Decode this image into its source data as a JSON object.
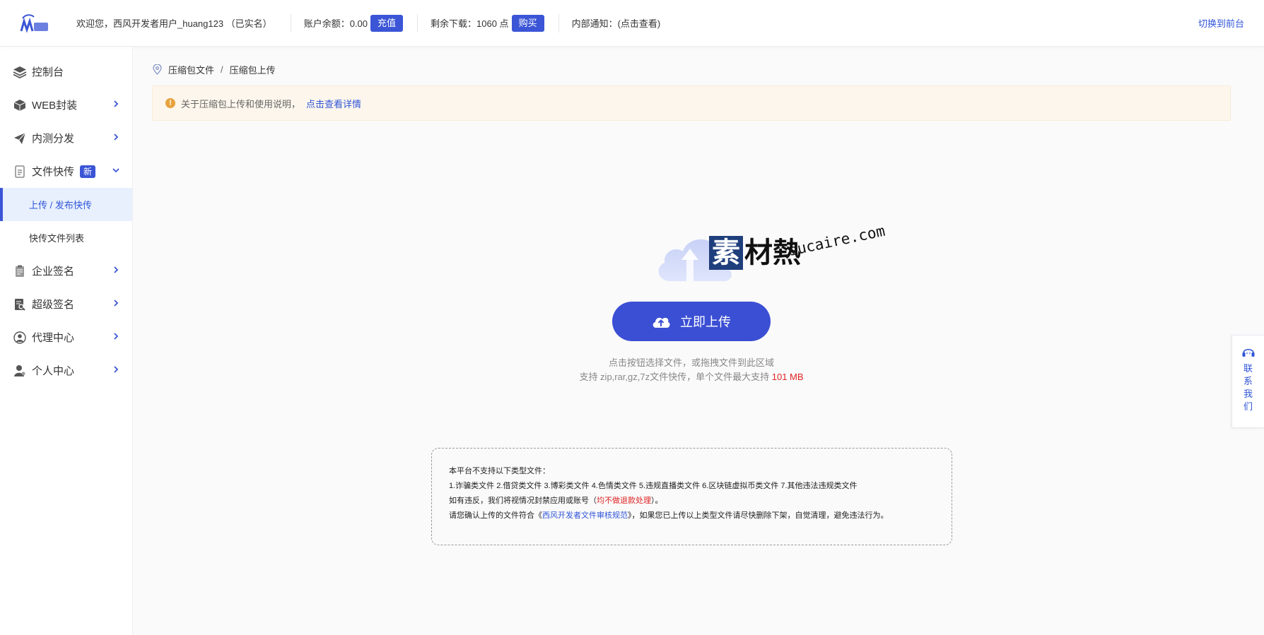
{
  "header": {
    "welcome": "欢迎您，西风开发者用户_huang123 （已实名）",
    "balance_label": "账户余额：0.00",
    "recharge_button": "充值",
    "downloads_label": "剩余下载：1060 点",
    "buy_button": "购买",
    "notice": "内部通知：(点击查看)",
    "switch_link": "切换到前台"
  },
  "sidebar": {
    "items": [
      {
        "label": "控制台",
        "icon": "layers-icon"
      },
      {
        "label": "WEB封装",
        "icon": "box-icon"
      },
      {
        "label": "内测分发",
        "icon": "paper-plane-icon"
      },
      {
        "label": "文件快传",
        "icon": "file-transfer-icon",
        "badge": "新"
      },
      {
        "label": "企业签名",
        "icon": "clipboard-icon"
      },
      {
        "label": "超级签名",
        "icon": "document-search-icon"
      },
      {
        "label": "代理中心",
        "icon": "agent-icon"
      },
      {
        "label": "个人中心",
        "icon": "user-icon"
      }
    ],
    "subitems": [
      {
        "label": "上传 / 发布快传",
        "active": true
      },
      {
        "label": "快传文件列表",
        "active": false
      }
    ]
  },
  "breadcrumb": {
    "root": "压缩包文件",
    "separator": "/",
    "current": "压缩包上传"
  },
  "alert": {
    "text": "关于压缩包上传和使用说明，",
    "link": "点击查看详情"
  },
  "watermark": {
    "cjk_first": "素",
    "cjk_rest": "材熱",
    "url": "sucaire.com"
  },
  "upload": {
    "button": "立即上传",
    "hint_line1": "点击按钮选择文件，或拖拽文件到此区域",
    "hint_line2_prefix": "支持 zip,rar,gz,7z文件快传，单个文件最大支持 ",
    "max_size": "101 MB"
  },
  "policy": {
    "title": "本平台不支持以下类型文件：",
    "types": "1.诈骗类文件 2.借贷类文件 3.博彩类文件 4.色情类文件 5.违规直播类文件 6.区块链虚拟币类文件 7.其他违法违规类文件",
    "violation_prefix": "如有违反，我们将视情况封禁应用或账号（",
    "violation_red": "均不做退款处理",
    "violation_suffix": "）。",
    "confirm_prefix": "请您确认上传的文件符合《",
    "confirm_link": "西风开发者文件审核规范",
    "confirm_suffix": "》，如果您已上传以上类型文件请尽快删除下架，自觉清理，避免违法行为。"
  },
  "contact": {
    "chars": [
      "联",
      "系",
      "我",
      "们"
    ]
  },
  "colors": {
    "primary": "#3b55d6",
    "link": "#2f54d8",
    "danger": "#e02424",
    "warning": "#e6a23c"
  }
}
